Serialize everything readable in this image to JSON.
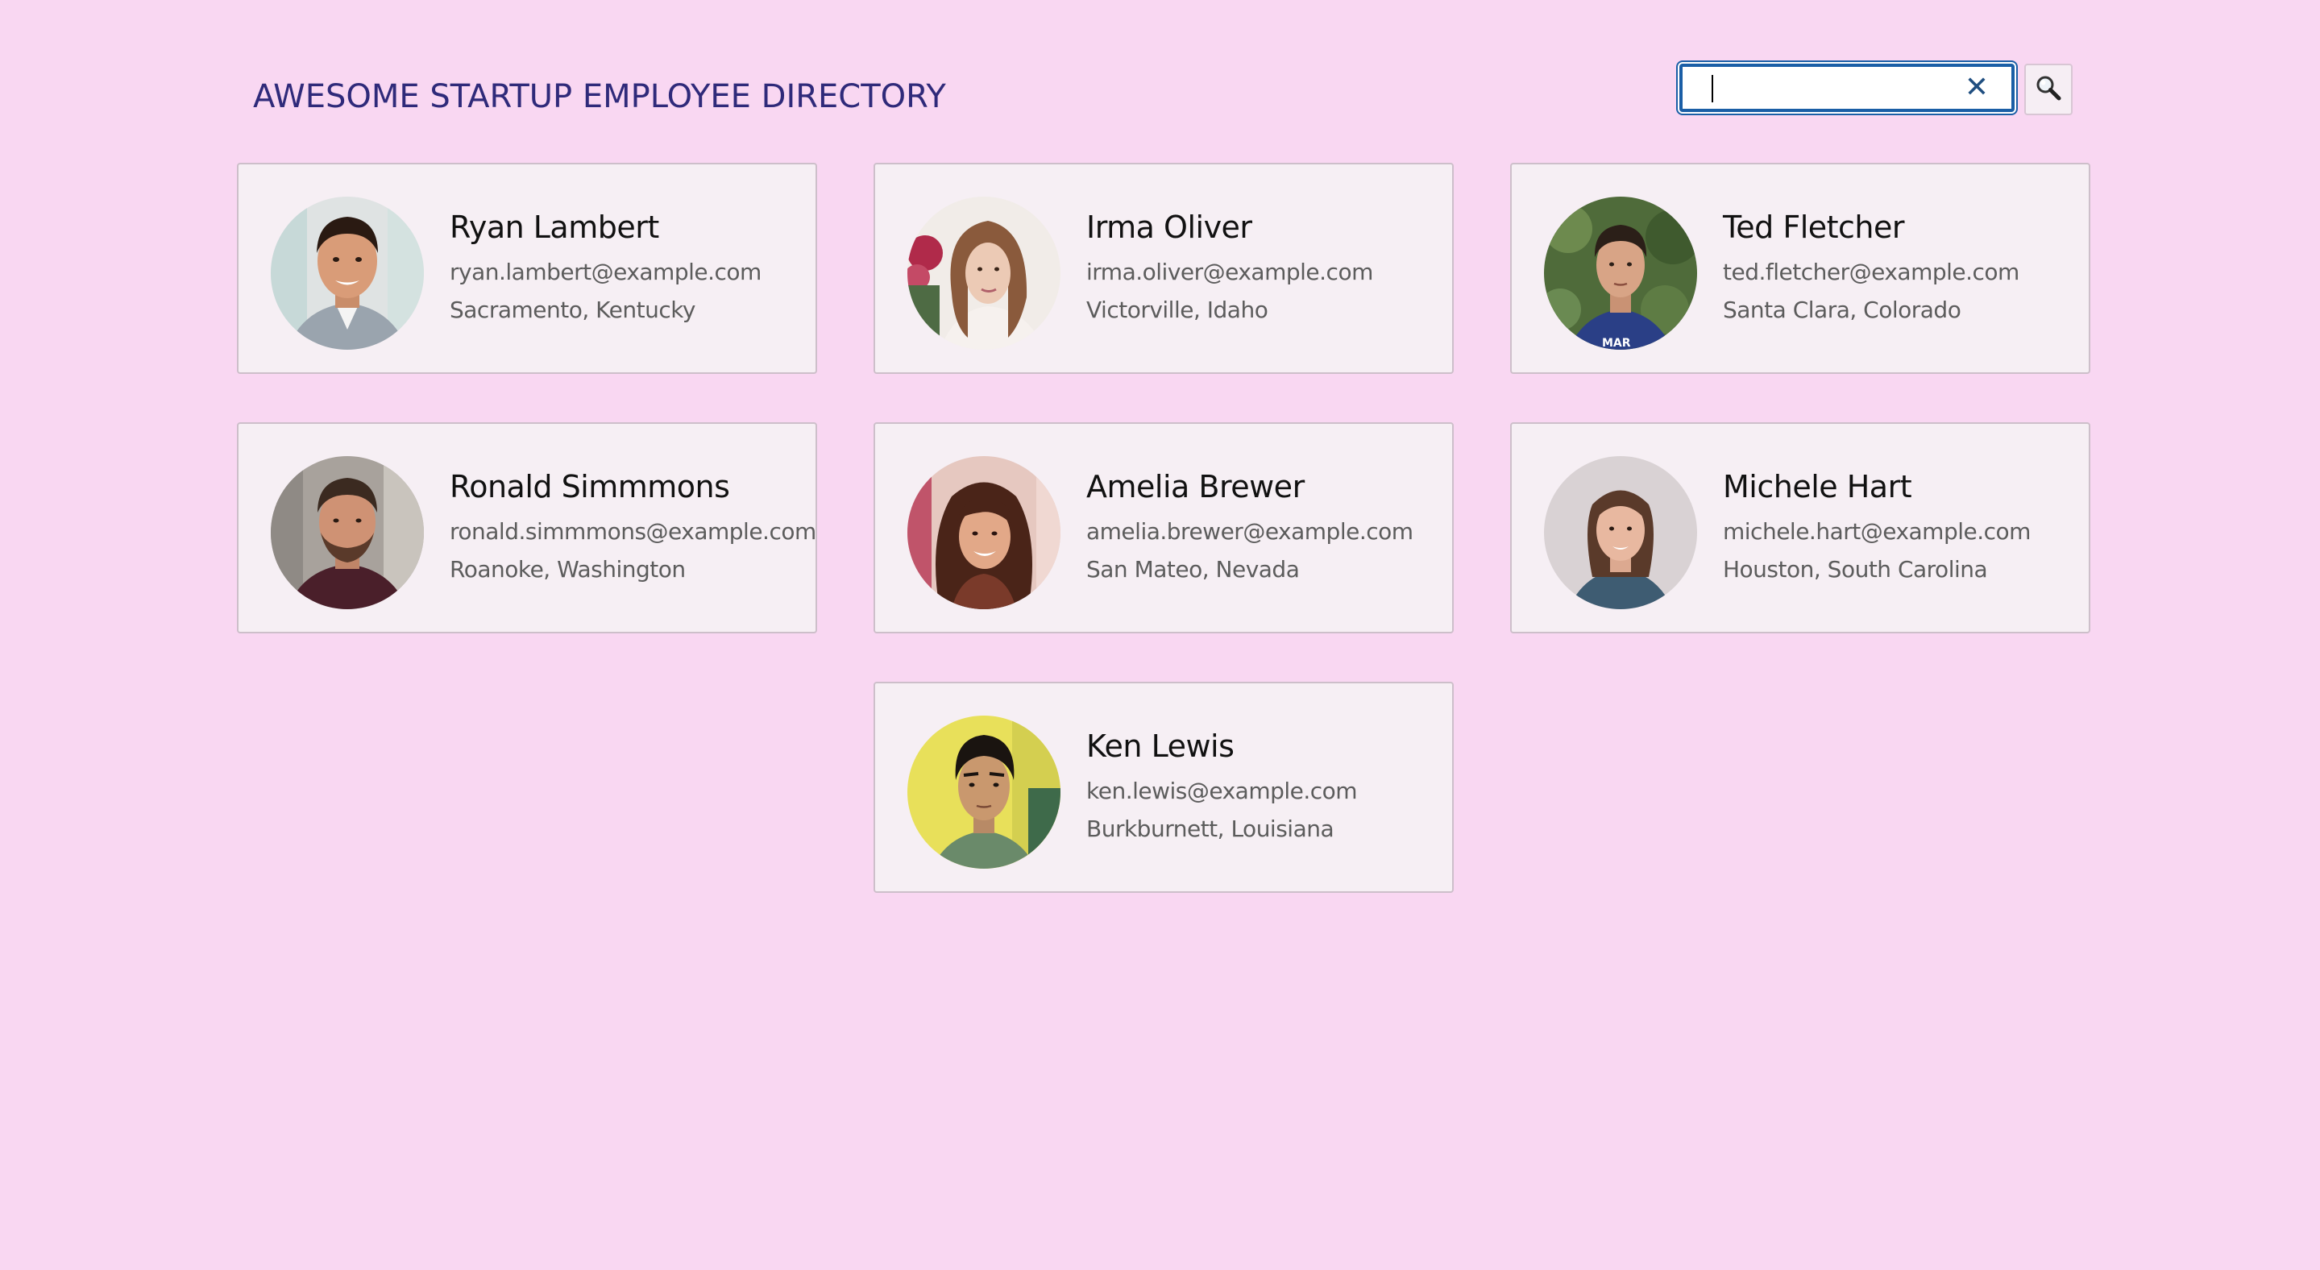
{
  "header": {
    "title": "AWESOME STARTUP EMPLOYEE DIRECTORY"
  },
  "search": {
    "value": "",
    "placeholder": "",
    "clear_icon": "close-icon",
    "button_icon": "search-icon"
  },
  "colors": {
    "background": "#f9d7f2",
    "title": "#2f2a7a",
    "card_background": "#f6eff4",
    "card_border": "#cdbfca",
    "search_focus": "#1a5ea6"
  },
  "employees": [
    {
      "name": "Ryan Lambert",
      "email": "ryan.lambert@example.com",
      "location": "Sacramento, Kentucky"
    },
    {
      "name": "Irma Oliver",
      "email": "irma.oliver@example.com",
      "location": "Victorville, Idaho"
    },
    {
      "name": "Ted Fletcher",
      "email": "ted.fletcher@example.com",
      "location": "Santa Clara, Colorado"
    },
    {
      "name": "Ronald Simmmons",
      "email": "ronald.simmmons@example.com",
      "location": "Roanoke, Washington"
    },
    {
      "name": "Amelia Brewer",
      "email": "amelia.brewer@example.com",
      "location": "San Mateo, Nevada"
    },
    {
      "name": "Michele Hart",
      "email": "michele.hart@example.com",
      "location": "Houston, South Carolina"
    },
    {
      "name": "Ken Lewis",
      "email": "ken.lewis@example.com",
      "location": "Burkburnett, Louisiana"
    }
  ]
}
